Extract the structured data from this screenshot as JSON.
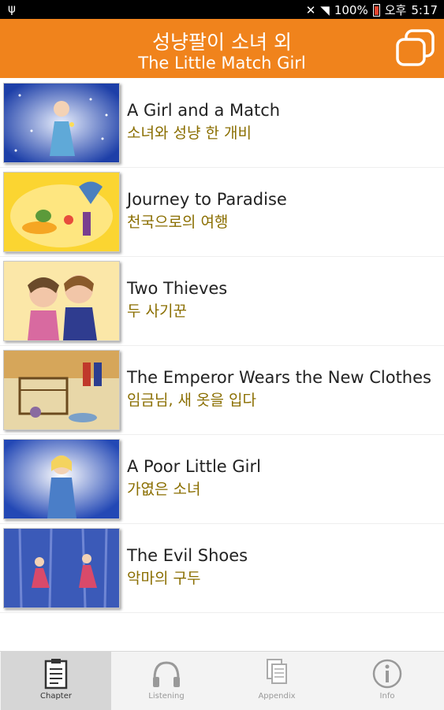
{
  "status_bar": {
    "battery": "100%",
    "ampm": "오후",
    "time": "5:17"
  },
  "header": {
    "title_ko": "성냥팔이 소녀 외",
    "title_en": "The Little Match Girl"
  },
  "chapters": [
    {
      "title_en": "A Girl and a Match",
      "title_ko": "소녀와 성냥 한 개비"
    },
    {
      "title_en": "Journey to Paradise",
      "title_ko": "천국으로의 여행"
    },
    {
      "title_en": "Two Thieves",
      "title_ko": "두 사기꾼"
    },
    {
      "title_en": "The Emperor Wears the New Clothes",
      "title_ko": "임금님, 새 옷을 입다"
    },
    {
      "title_en": "A Poor Little Girl",
      "title_ko": "가엾은 소녀"
    },
    {
      "title_en": "The Evil Shoes",
      "title_ko": "악마의 구두"
    }
  ],
  "tabs": [
    {
      "label": "Chapter",
      "icon": "clipboard-icon"
    },
    {
      "label": "Listening",
      "icon": "headphones-icon"
    },
    {
      "label": "Appendix",
      "icon": "documents-icon"
    },
    {
      "label": "Info",
      "icon": "info-icon"
    }
  ],
  "colors": {
    "header": "#f0831c",
    "korean_text": "#8a6e00"
  }
}
